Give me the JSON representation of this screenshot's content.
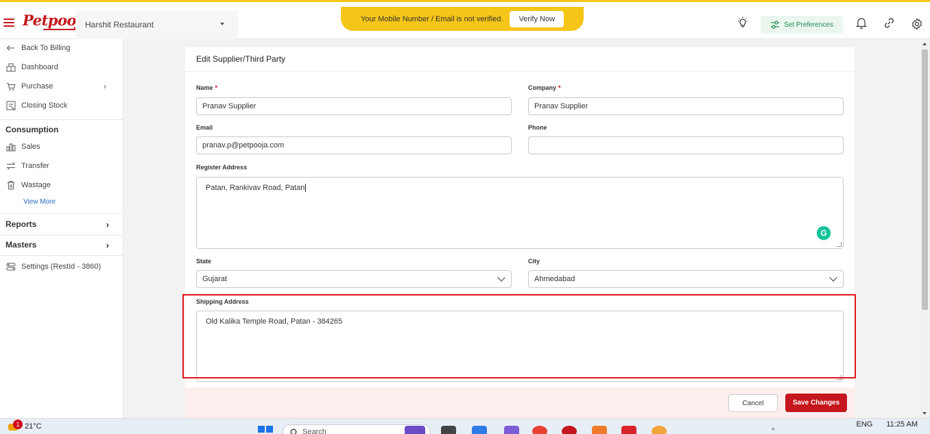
{
  "header": {
    "logo_text": "Petpooja",
    "restaurant": "Harshit Restaurant",
    "verify_message": "Your Mobile Number / Email is not verified.",
    "verify_button": "Verify Now",
    "set_preferences": "Set Preferences"
  },
  "sidebar": {
    "back": "Back To Billing",
    "dashboard": "Dashboard",
    "purchase": "Purchase",
    "closing_stock": "Closing Stock",
    "consumption_heading": "Consumption",
    "sales": "Sales",
    "transfer": "Transfer",
    "wastage": "Wastage",
    "view_more": "View More",
    "reports": "Reports",
    "masters": "Masters",
    "settings": "Settings (RestId - 3860)"
  },
  "form": {
    "title": "Edit Supplier/Third Party",
    "name_label": "Name",
    "name_value": "Pranav Supplier",
    "company_label": "Company",
    "company_value": "Pranav Supplier",
    "email_label": "Email",
    "email_value": "pranav.p@petpooja.com",
    "phone_label": "Phone",
    "phone_value": "",
    "register_address_label": "Register Address",
    "register_address_value": "Patan, Rankivav Road, Patan",
    "state_label": "State",
    "state_value": "Gujarat",
    "city_label": "City",
    "city_value": "Ahmedabad",
    "shipping_address_label": "Shipping Address",
    "shipping_address_value": "Old Kalika Temple Road, Patan - 384265",
    "required_marker": "*",
    "cancel_button": "Cancel",
    "save_button": "Save Changes"
  },
  "taskbar": {
    "notification_count": "1",
    "temperature": "21°C",
    "search_placeholder": "Search",
    "language": "ENG",
    "time": "11:25 AM"
  },
  "colors": {
    "brand_red": "#c4161c",
    "banner_yellow": "#f5c518",
    "highlight_red": "#e0131c",
    "preferences_green": "#1f8a4c"
  }
}
